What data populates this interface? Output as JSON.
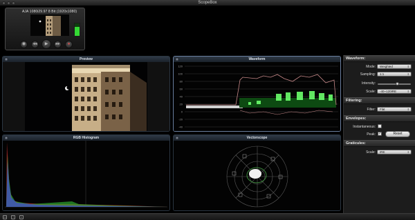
{
  "window": {
    "title": "ScopeBox"
  },
  "source": {
    "info": "AJA 1080i29.97     8 Bit   (1920x1080)",
    "audio_level": 0.75,
    "level_color": "#34d934"
  },
  "transport": {
    "buttons": [
      {
        "icon": "camera-icon",
        "glyph": "◉"
      },
      {
        "icon": "rewind-icon",
        "glyph": "◂◂"
      },
      {
        "icon": "play-icon",
        "glyph": "▶"
      },
      {
        "icon": "forward-icon",
        "glyph": "▸▸"
      },
      {
        "icon": "record-icon",
        "glyph": "●"
      }
    ]
  },
  "panels": {
    "preview": {
      "title": "Preview"
    },
    "waveform": {
      "title": "Waveform",
      "scale_labels": [
        "120",
        "100",
        "80",
        "60",
        "40",
        "20",
        "0",
        "-20",
        "-40"
      ]
    },
    "histogram": {
      "title": "RGB Histogram"
    },
    "vectorscope": {
      "title": "Vectorscope"
    }
  },
  "sidebar": {
    "waveform": {
      "heading": "Waveform:",
      "mode_label": "Mode:",
      "mode_value": "Weighted",
      "sampling_label": "Sampling:",
      "sampling_value": "1:1",
      "intensity_label": "Intensity:",
      "intensity_level": 0.6,
      "scale_label": "Scale:",
      "scale_value": "-40~120IRE"
    },
    "filtering": {
      "heading": "Filtering:",
      "filter_label": "Filter:",
      "filter_value": "Flat"
    },
    "envelopes": {
      "heading": "Envelopes:",
      "instantaneous_label": "Instantaneous:",
      "instantaneous_checked": false,
      "peak_label": "Peak:",
      "peak_checked": true,
      "peak_mark": "✓",
      "reset_label": "Reset"
    },
    "graticules": {
      "heading": "Graticules:",
      "scale_label": "Scale:",
      "scale_value": "IRE"
    }
  },
  "statusbar": {
    "icons": [
      "layout-icon",
      "add-icon",
      "lock-icon"
    ]
  }
}
